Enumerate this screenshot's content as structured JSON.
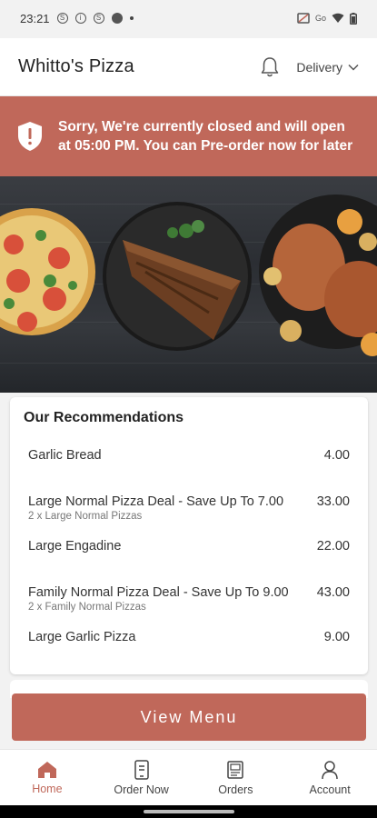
{
  "status_bar": {
    "time": "23:21",
    "left_icons": [
      "s-icon",
      "info-icon",
      "s-icon",
      "app-icon"
    ],
    "right_icons": [
      "no-sim-icon",
      "go-icon",
      "wifi-icon",
      "battery-icon"
    ]
  },
  "header": {
    "brand": "Whitto's Pizza",
    "delivery_label": "Delivery"
  },
  "banner": {
    "message": "Sorry, We're currently closed and will open at 05:00 PM. You can Pre-order now for later"
  },
  "recommendations": {
    "title": "Our Recommendations",
    "items": [
      {
        "name": "Garlic Bread",
        "sub": "",
        "price": "4.00"
      },
      {
        "name": "Large Normal Pizza Deal - Save Up To 7.00",
        "sub": "2 x Large Normal Pizzas",
        "price": "33.00"
      },
      {
        "name": "Large Engadine",
        "sub": "",
        "price": "22.00"
      },
      {
        "name": "Family Normal Pizza Deal - Save Up To 9.00",
        "sub": "2 x Family Normal Pizzas",
        "price": "43.00"
      },
      {
        "name": "Large Garlic Pizza",
        "sub": "",
        "price": "9.00"
      }
    ]
  },
  "view_menu_label": "View Menu",
  "bottom_nav": {
    "items": [
      {
        "label": "Home",
        "active": true
      },
      {
        "label": "Order Now",
        "active": false
      },
      {
        "label": "Orders",
        "active": false
      },
      {
        "label": "Account",
        "active": false
      }
    ]
  },
  "colors": {
    "accent": "#c0685a",
    "background": "#f2f2f2"
  }
}
